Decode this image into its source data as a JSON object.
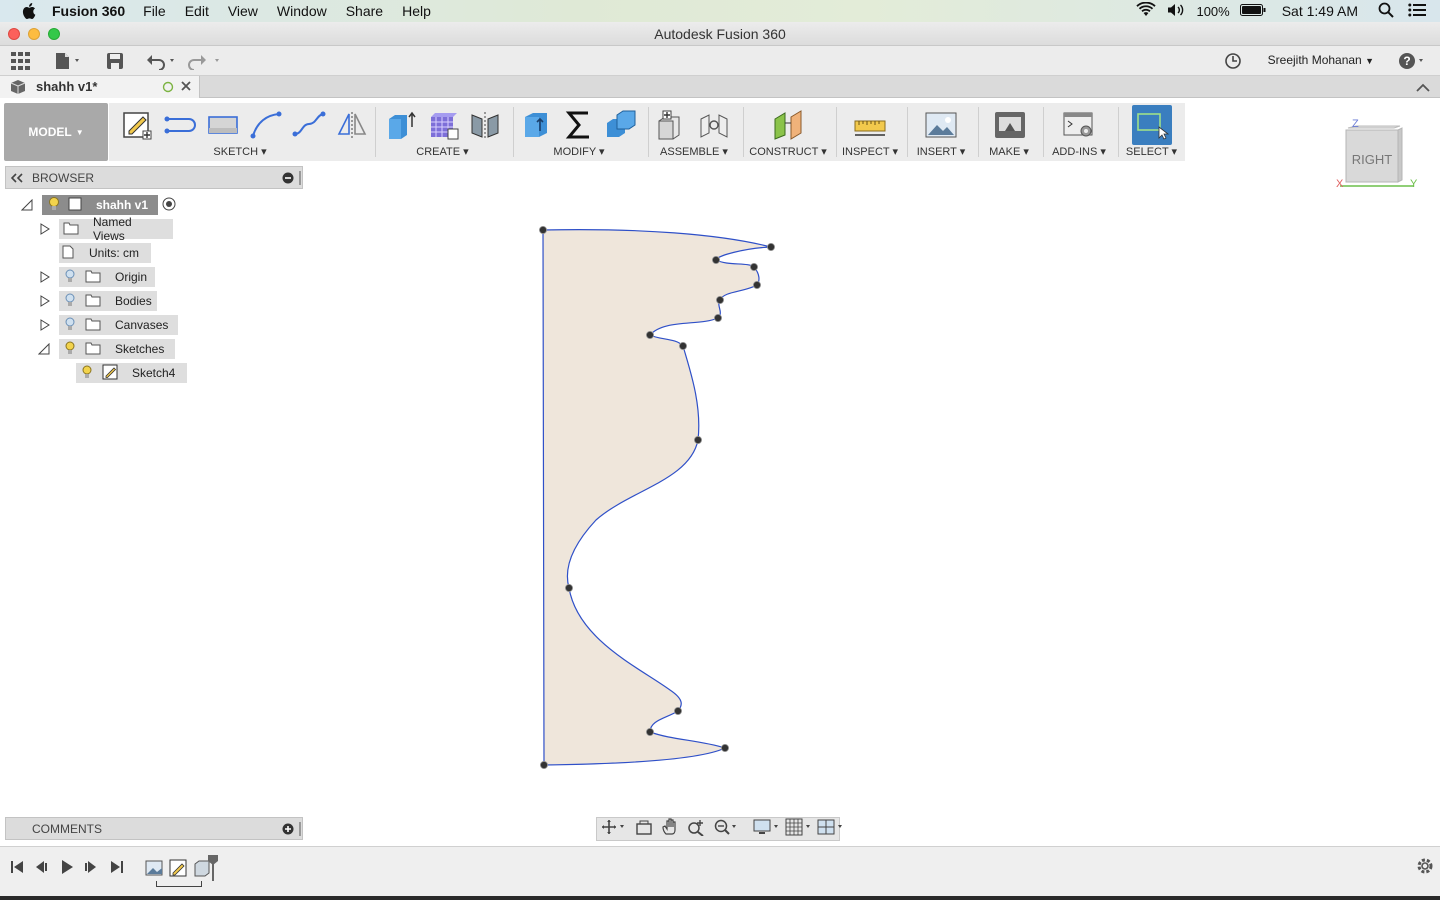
{
  "menubar": {
    "app_name": "Fusion 360",
    "menus": [
      "File",
      "Edit",
      "View",
      "Window",
      "Share",
      "Help"
    ],
    "battery": "100%",
    "clock": "Sat 1:49 AM"
  },
  "window": {
    "title": "Autodesk Fusion 360"
  },
  "quick_access": {
    "user_name": "Sreejith Mohanan"
  },
  "document_tab": {
    "title": "shahh v1*"
  },
  "ribbon": {
    "workspace": "MODEL",
    "groups": {
      "sketch": "SKETCH",
      "create": "CREATE",
      "modify": "MODIFY",
      "assemble": "ASSEMBLE",
      "construct": "CONSTRUCT",
      "inspect": "INSPECT",
      "insert": "INSERT",
      "make": "MAKE",
      "addins": "ADD-INS",
      "select": "SELECT"
    }
  },
  "browser": {
    "title": "BROWSER",
    "root": "shahh v1",
    "items": {
      "named_views": "Named Views",
      "units": "Units: cm",
      "origin": "Origin",
      "bodies": "Bodies",
      "canvases": "Canvases",
      "sketches": "Sketches",
      "sketch4": "Sketch4"
    }
  },
  "viewcube": {
    "face": "RIGHT",
    "axis_z": "Z",
    "axis_x": "X",
    "axis_y": "Y"
  },
  "comments": {
    "title": "COMMENTS"
  },
  "colors": {
    "sketch_line": "#2f50c8",
    "profile_fill": "#efe6db",
    "selected_node": "#8c8c8c",
    "select_tool": "#3a7ebf"
  }
}
